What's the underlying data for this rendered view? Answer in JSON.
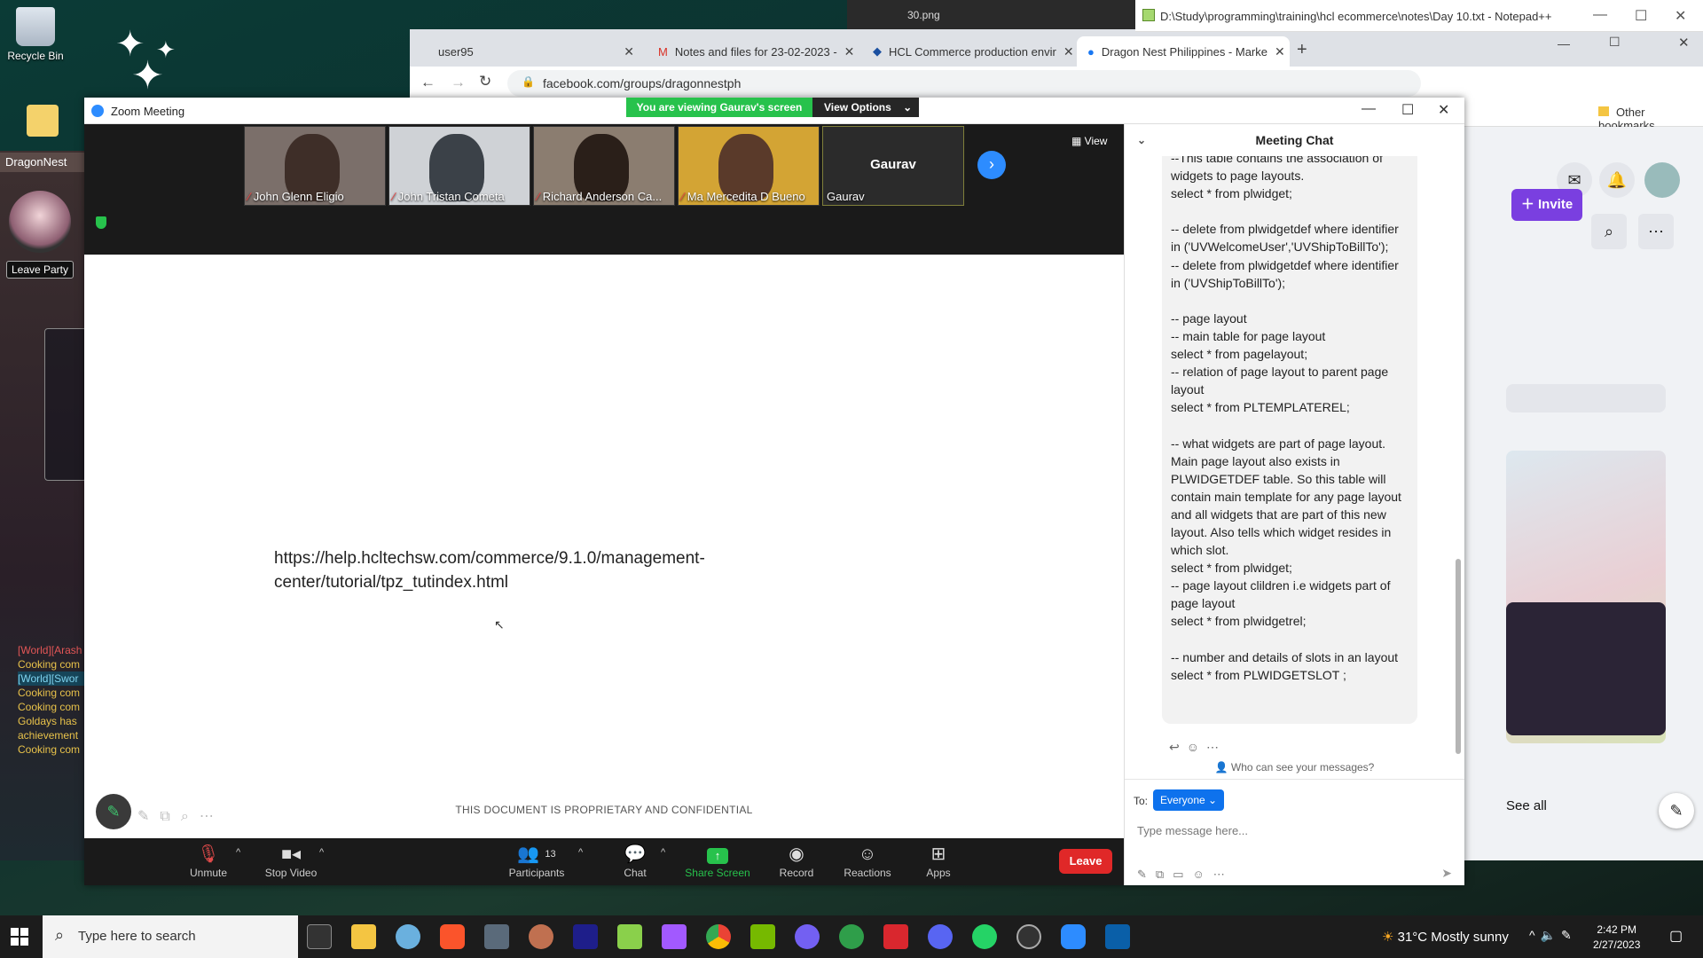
{
  "desktop": {
    "icons": [
      {
        "label": "Recycle Bin"
      }
    ]
  },
  "game": {
    "tab_label": "DragonNest",
    "leave_party": "Leave Party",
    "chat_lines": [
      "[World][Arash",
      "Cooking com",
      "[World][Swor",
      "Cooking com",
      "Cooking com",
      "Goldays has",
      "achievement",
      "Cooking com"
    ]
  },
  "notepad": {
    "title": "D:\\Study\\programming\\training\\hcl ecommerce\\notes\\Day 10.txt - Notepad++"
  },
  "behind_window": {
    "title": "30.png"
  },
  "browser": {
    "tabs": [
      {
        "label": "user95"
      },
      {
        "label": "Notes and files for 23-02-2023 -"
      },
      {
        "label": "HCL Commerce production envir"
      },
      {
        "label": "Dragon Nest Philippines - Marke"
      }
    ],
    "url": "facebook.com/groups/dragonnestph",
    "other_bookmarks": "Other bookmarks",
    "invite": "Invite",
    "see_all": "See all"
  },
  "zoom": {
    "window_title": "Zoom Meeting",
    "viewing_banner": "You are viewing Gaurav's screen",
    "view_options": "View Options",
    "view_button": "View",
    "participants": [
      {
        "name": "John Glenn Eligio",
        "color": "#6b5a4e"
      },
      {
        "name": "John Tristan Cometa",
        "color": "#9aa0a8"
      },
      {
        "name": "Richard Anderson Ca...",
        "color": "#4c3b30"
      },
      {
        "name": "Ma Mercedita D Bueno",
        "color": "#c89a3a"
      },
      {
        "name": "Gaurav",
        "color": "#2b2b2b"
      }
    ],
    "gaurav_big": "Gaurav",
    "shared_url": "https://help.hcltechsw.com/commerce/9.1.0/management-center/tutorial/tpz_tutindex.html",
    "confidential": "THIS DOCUMENT IS PROPRIETARY AND CONFIDENTIAL",
    "controls": {
      "unmute": "Unmute",
      "stop_video": "Stop Video",
      "participants": "Participants",
      "participants_count": "13",
      "chat": "Chat",
      "share_screen": "Share Screen",
      "record": "Record",
      "reactions": "Reactions",
      "apps": "Apps",
      "leave": "Leave"
    },
    "chat": {
      "title": "Meeting Chat",
      "message": "--This table contains the association of widgets to page layouts.\nselect * from plwidget;\n\n-- delete from plwidgetdef where identifier in ('UVWelcomeUser','UVShipToBillTo');\n-- delete from plwidgetdef where identifier in ('UVShipToBillTo');\n\n-- page layout\n-- main table for page layout\nselect * from pagelayout;\n-- relation of page layout to parent page layout\nselect * from PLTEMPLATEREL;\n\n-- what widgets are part of page layout. Main page layout also exists in PLWIDGETDEF table. So this table will contain main template for any page layout and all widgets that are part of this new layout. Also tells which widget resides in which slot.\nselect * from plwidget;\n-- page layout clildren i.e widgets part of page layout\nselect * from plwidgetrel;\n\n-- number and details of slots in an layout\nselect * from PLWIDGETSLOT ;",
      "who_can_see": "Who can see your messages?",
      "to_label": "To:",
      "recipient": "Everyone",
      "placeholder": "Type message here..."
    }
  },
  "taskbar": {
    "search_placeholder": "Type here to search",
    "weather": "31°C  Mostly sunny",
    "time": "2:42 PM",
    "date": "2/27/2023"
  }
}
